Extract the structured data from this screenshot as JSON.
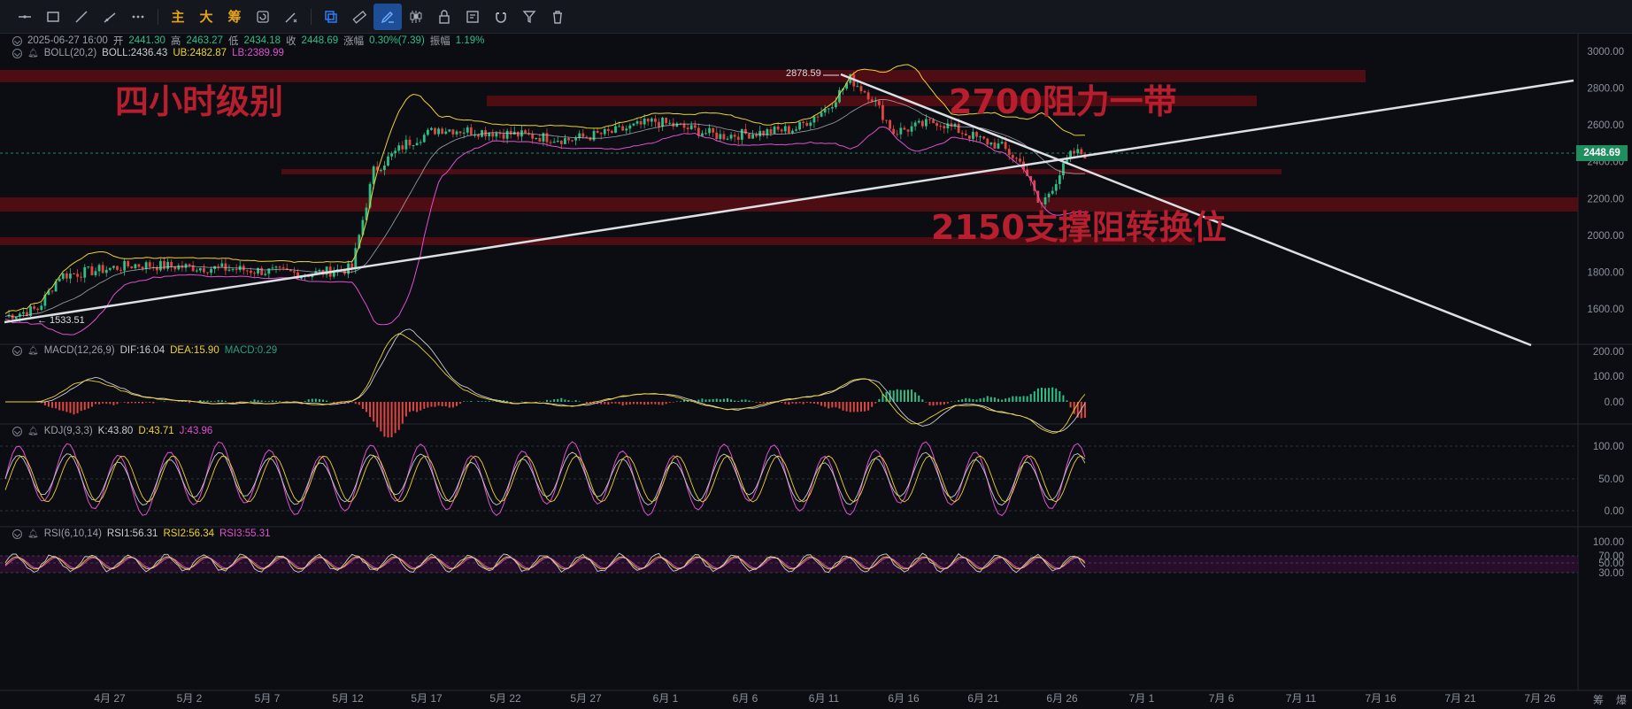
{
  "toolbar": {
    "tools": [
      {
        "name": "horizontal-line-tool-icon",
        "glyph": "—"
      },
      {
        "name": "rectangle-tool-icon",
        "glyph": "▭"
      },
      {
        "name": "trend-line-tool-icon",
        "glyph": "⟋"
      },
      {
        "name": "ray-tool-icon",
        "glyph": "⟋"
      },
      {
        "name": "more-tools-icon",
        "glyph": "⋯"
      }
    ],
    "text_buttons": [
      "主",
      "大",
      "筹"
    ],
    "right_tools": [
      {
        "name": "copy-icon"
      },
      {
        "name": "ruler-icon"
      },
      {
        "name": "draw-pen-icon",
        "active": true
      },
      {
        "name": "candlestick-icon"
      },
      {
        "name": "lock-icon"
      },
      {
        "name": "settings-panel-icon"
      },
      {
        "name": "magnet-icon"
      },
      {
        "name": "filter-icon"
      },
      {
        "name": "delete-icon"
      }
    ]
  },
  "ohlc": {
    "datetime": "2025-06-27 16:00",
    "open_label": "开",
    "open": "2441.30",
    "high_label": "高",
    "high": "2463.27",
    "low_label": "低",
    "low": "2434.18",
    "close_label": "收",
    "close": "2448.69",
    "change_label": "涨幅",
    "change": "0.30%(7.39)",
    "amp_label": "振幅",
    "amp": "1.19%"
  },
  "boll": {
    "name": "BOLL(20,2)",
    "boll": "BOLL:2436.43",
    "ub": "UB:2482.87",
    "lb": "LB:2389.99"
  },
  "macd": {
    "name": "MACD(12,26,9)",
    "dif": "DIF:16.04",
    "dea": "DEA:15.90",
    "macd": "MACD:0.29"
  },
  "kdj": {
    "name": "KDJ(9,3,3)",
    "k": "K:43.80",
    "d": "D:43.71",
    "j": "J:43.96"
  },
  "rsi": {
    "name": "RSI(6,10,14)",
    "r1": "RSI1:56.31",
    "r2": "RSI2:56.34",
    "r3": "RSI3:55.31"
  },
  "price_axis": [
    "3000.00",
    "2800.00",
    "2600.00",
    "2400.00",
    "2200.00",
    "2000.00",
    "1800.00",
    "1600.00"
  ],
  "current_price": "2448.69",
  "macd_axis": [
    "200.00",
    "100.00",
    "0.00"
  ],
  "kdj_axis": [
    "100.00",
    "50.00",
    "0.00"
  ],
  "rsi_axis": [
    "100.00",
    "70.00",
    "50.00",
    "30.00"
  ],
  "x_axis": [
    "4月 27",
    "5月 2",
    "5月 7",
    "5月 12",
    "5月 17",
    "5月 22",
    "5月 27",
    "6月 1",
    "6月 6",
    "6月 11",
    "6月 16",
    "6月 21",
    "6月 26",
    "7月 1",
    "7月 6",
    "7月 11",
    "7月 16",
    "7月 21",
    "7月 26"
  ],
  "corner_labels": [
    "筹",
    "爆"
  ],
  "annotations": {
    "title": "四小时级别",
    "resistance": "2700阻力一带",
    "support": "2150支撑阻转换位",
    "high_tag": "2878.59",
    "low_tag": "1533.51"
  },
  "colors": {
    "up": "#2fbf86",
    "down": "#e0463f",
    "boll_mid": "#c8ccd3",
    "ub": "#f0d22a",
    "lb": "#e04fd0",
    "zone": "#5a0d14",
    "annot": "#b81e2e"
  }
}
